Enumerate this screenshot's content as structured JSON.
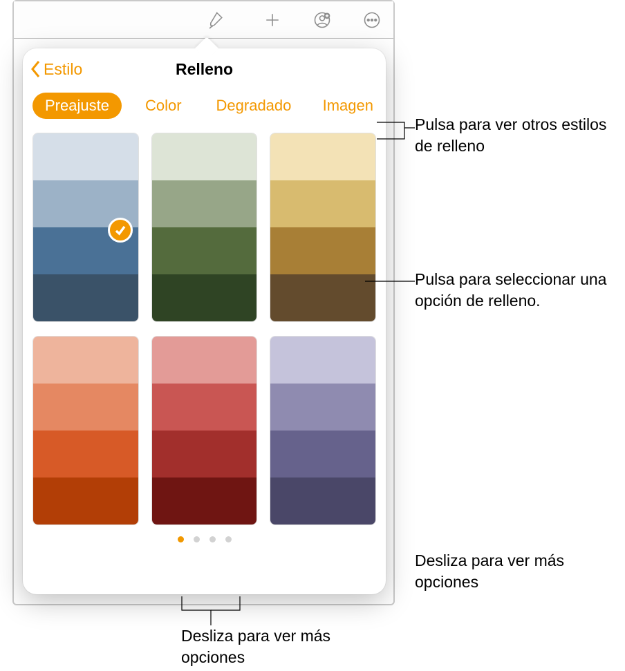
{
  "toolbar": {
    "icons": [
      "brush-icon",
      "plus-icon",
      "add-person-icon",
      "more-icon"
    ]
  },
  "popover": {
    "back_label": "Estilo",
    "title": "Relleno",
    "tabs": {
      "preset": "Preajuste",
      "color": "Color",
      "gradient": "Degradado",
      "image": "Imagen",
      "active_index": 0
    },
    "palettes": [
      {
        "selected": true,
        "stripes": [
          "#d5dee8",
          "#9cb2c7",
          "#4a7196",
          "#3a5268"
        ]
      },
      {
        "selected": false,
        "stripes": [
          "#dde4d6",
          "#97a688",
          "#546b3d",
          "#2f4424"
        ]
      },
      {
        "selected": false,
        "stripes": [
          "#f3e2b6",
          "#d8bb6f",
          "#a87f36",
          "#634b2d"
        ]
      },
      {
        "selected": false,
        "stripes": [
          "#eeb49c",
          "#e58862",
          "#d75a27",
          "#b23e06"
        ]
      },
      {
        "selected": false,
        "stripes": [
          "#e39b97",
          "#c95653",
          "#a22f2c",
          "#6f1512"
        ]
      },
      {
        "selected": false,
        "stripes": [
          "#c5c3db",
          "#8f8bb0",
          "#66628c",
          "#4a4768"
        ]
      }
    ],
    "pager": {
      "total": 4,
      "active": 0
    }
  },
  "callouts": {
    "c1": "Pulsa para ver otros estilos de relleno",
    "c2": "Pulsa para seleccionar una opción de relleno.",
    "c3": "Desliza para ver más opciones",
    "c4": "Desliza para ver más opciones"
  }
}
